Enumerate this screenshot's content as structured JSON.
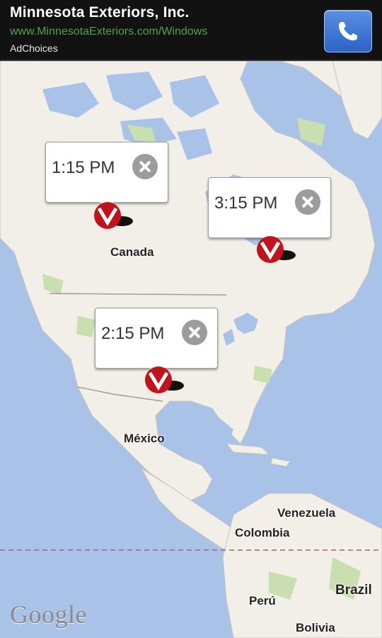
{
  "ad": {
    "title": "Minnesota Exteriors, Inc.",
    "url": "www.MinnesotaExteriors.com/Windows",
    "choices": "AdChoices"
  },
  "map": {
    "labels": {
      "canada": "Canada",
      "mexico": "México",
      "venezuela": "Venezuela",
      "colombia": "Colombia",
      "brazil": "Brazil",
      "peru": "Perú",
      "bolivia": "Bolivia"
    },
    "attribution": "Google"
  },
  "pins": [
    {
      "time": "1:15 PM"
    },
    {
      "time": "3:15 PM"
    },
    {
      "time": "2:15 PM"
    }
  ],
  "colors": {
    "ocean": "#a9c3e8",
    "land": "#f2efe9",
    "park": "#c9dfaf",
    "marker_red": "#c3121b",
    "ad_url_green": "#4fa34f",
    "call_blue": "#3b73d6"
  }
}
